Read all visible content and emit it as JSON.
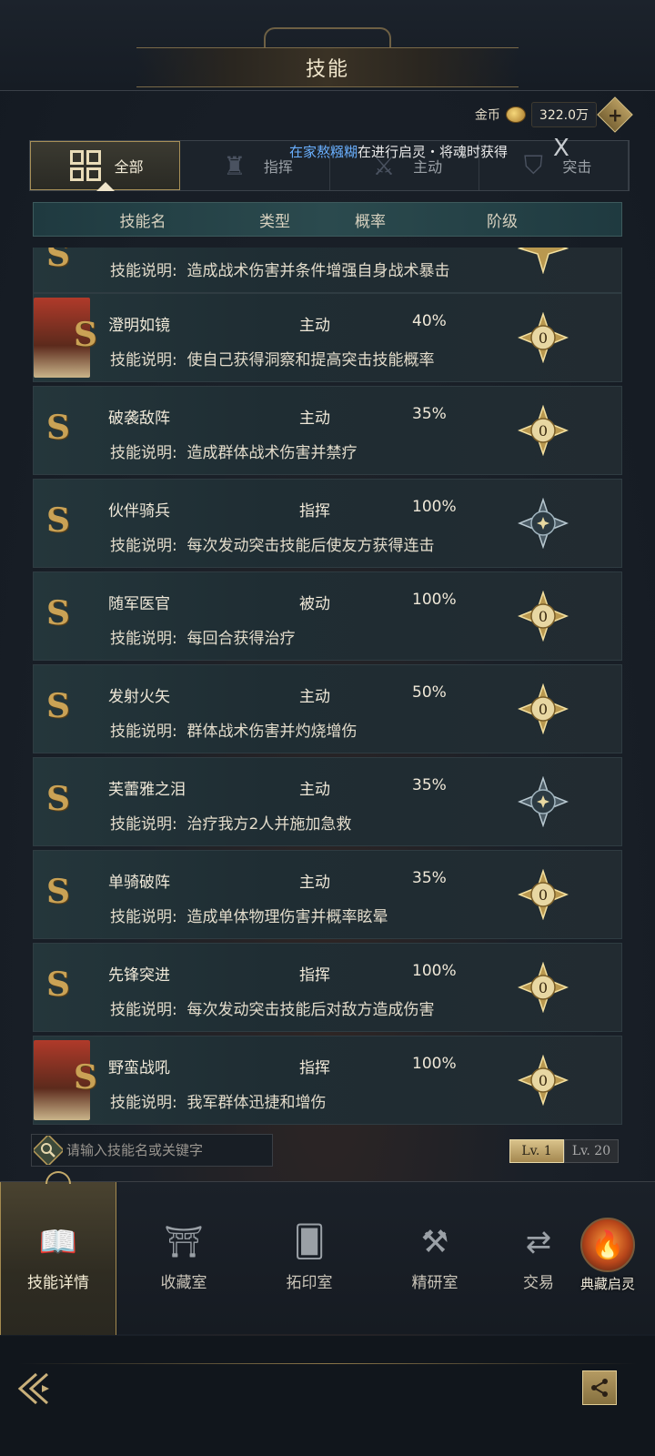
{
  "header": {
    "title": "技能"
  },
  "currency": {
    "label": "金币",
    "value": "322.0万",
    "add_symbol": "+"
  },
  "tabs": [
    {
      "label": "全部",
      "icon": "grid-icon",
      "active": true
    },
    {
      "label": "指挥",
      "icon": "tower-icon",
      "active": false
    },
    {
      "label": "主动",
      "icon": "swords-icon",
      "active": false
    },
    {
      "label": "突击",
      "icon": "crest-icon",
      "active": false
    }
  ],
  "ticker": {
    "player": "在家熬糨糊",
    "message": "在进行启灵・将魂时获得",
    "close": "X"
  },
  "table": {
    "headers": {
      "name": "技能名",
      "type": "类型",
      "rate": "概率",
      "rank": "阶级"
    },
    "desc_prefix": "技能说明:",
    "partial_row": {
      "desc": "造成战术伤害并条件增强自身战术暴击"
    },
    "rows": [
      {
        "name": "澄明如镜",
        "type": "主动",
        "rate": "40%",
        "desc": "使自己获得洞察和提高突击技能概率",
        "portrait": true,
        "rank": "0",
        "rank_style": "gold"
      },
      {
        "name": "破袭敌阵",
        "type": "主动",
        "rate": "35%",
        "desc": "造成群体战术伤害并禁疗",
        "portrait": false,
        "rank": "0",
        "rank_style": "gold"
      },
      {
        "name": "伙伴骑兵",
        "type": "指挥",
        "rate": "100%",
        "desc": "每次发动突击技能后使友方获得连击",
        "portrait": false,
        "rank": "",
        "rank_style": "silver"
      },
      {
        "name": "随军医官",
        "type": "被动",
        "rate": "100%",
        "desc": "每回合获得治疗",
        "portrait": false,
        "rank": "0",
        "rank_style": "gold"
      },
      {
        "name": "发射火矢",
        "type": "主动",
        "rate": "50%",
        "desc": "群体战术伤害并灼烧增伤",
        "portrait": false,
        "rank": "0",
        "rank_style": "gold"
      },
      {
        "name": "芙蕾雅之泪",
        "type": "主动",
        "rate": "35%",
        "desc": "治疗我方2人并施加急救",
        "portrait": false,
        "rank": "",
        "rank_style": "silver"
      },
      {
        "name": "单骑破阵",
        "type": "主动",
        "rate": "35%",
        "desc": "造成单体物理伤害并概率眩晕",
        "portrait": false,
        "rank": "0",
        "rank_style": "gold"
      },
      {
        "name": "先锋突进",
        "type": "指挥",
        "rate": "100%",
        "desc": "每次发动突击技能后对敌方造成伤害",
        "portrait": false,
        "rank": "0",
        "rank_style": "gold"
      },
      {
        "name": "野蛮战吼",
        "type": "指挥",
        "rate": "100%",
        "desc": "我军群体迅捷和增伤",
        "portrait": true,
        "rank": "0",
        "rank_style": "gold"
      }
    ],
    "s_badge": "S"
  },
  "search": {
    "placeholder": "请输入技能名或关键字"
  },
  "level_toggle": {
    "on": "Lv. 1",
    "off": "Lv. 20"
  },
  "bottom_nav": [
    {
      "label": "技能详情",
      "icon": "skill-book-icon",
      "active": true
    },
    {
      "label": "收藏室",
      "icon": "gate-icon",
      "active": false
    },
    {
      "label": "拓印室",
      "icon": "cards-icon",
      "active": false
    },
    {
      "label": "精研室",
      "icon": "hammer-icon",
      "active": false
    },
    {
      "label": "交易",
      "icon": "trade-icon",
      "active": false
    }
  ],
  "collection_button": {
    "label": "典藏启灵",
    "icon": "flame-icon"
  },
  "colors": {
    "gold": "#caa255",
    "accent_blue": "#6ab0ff",
    "panel": "#1f2d33"
  }
}
